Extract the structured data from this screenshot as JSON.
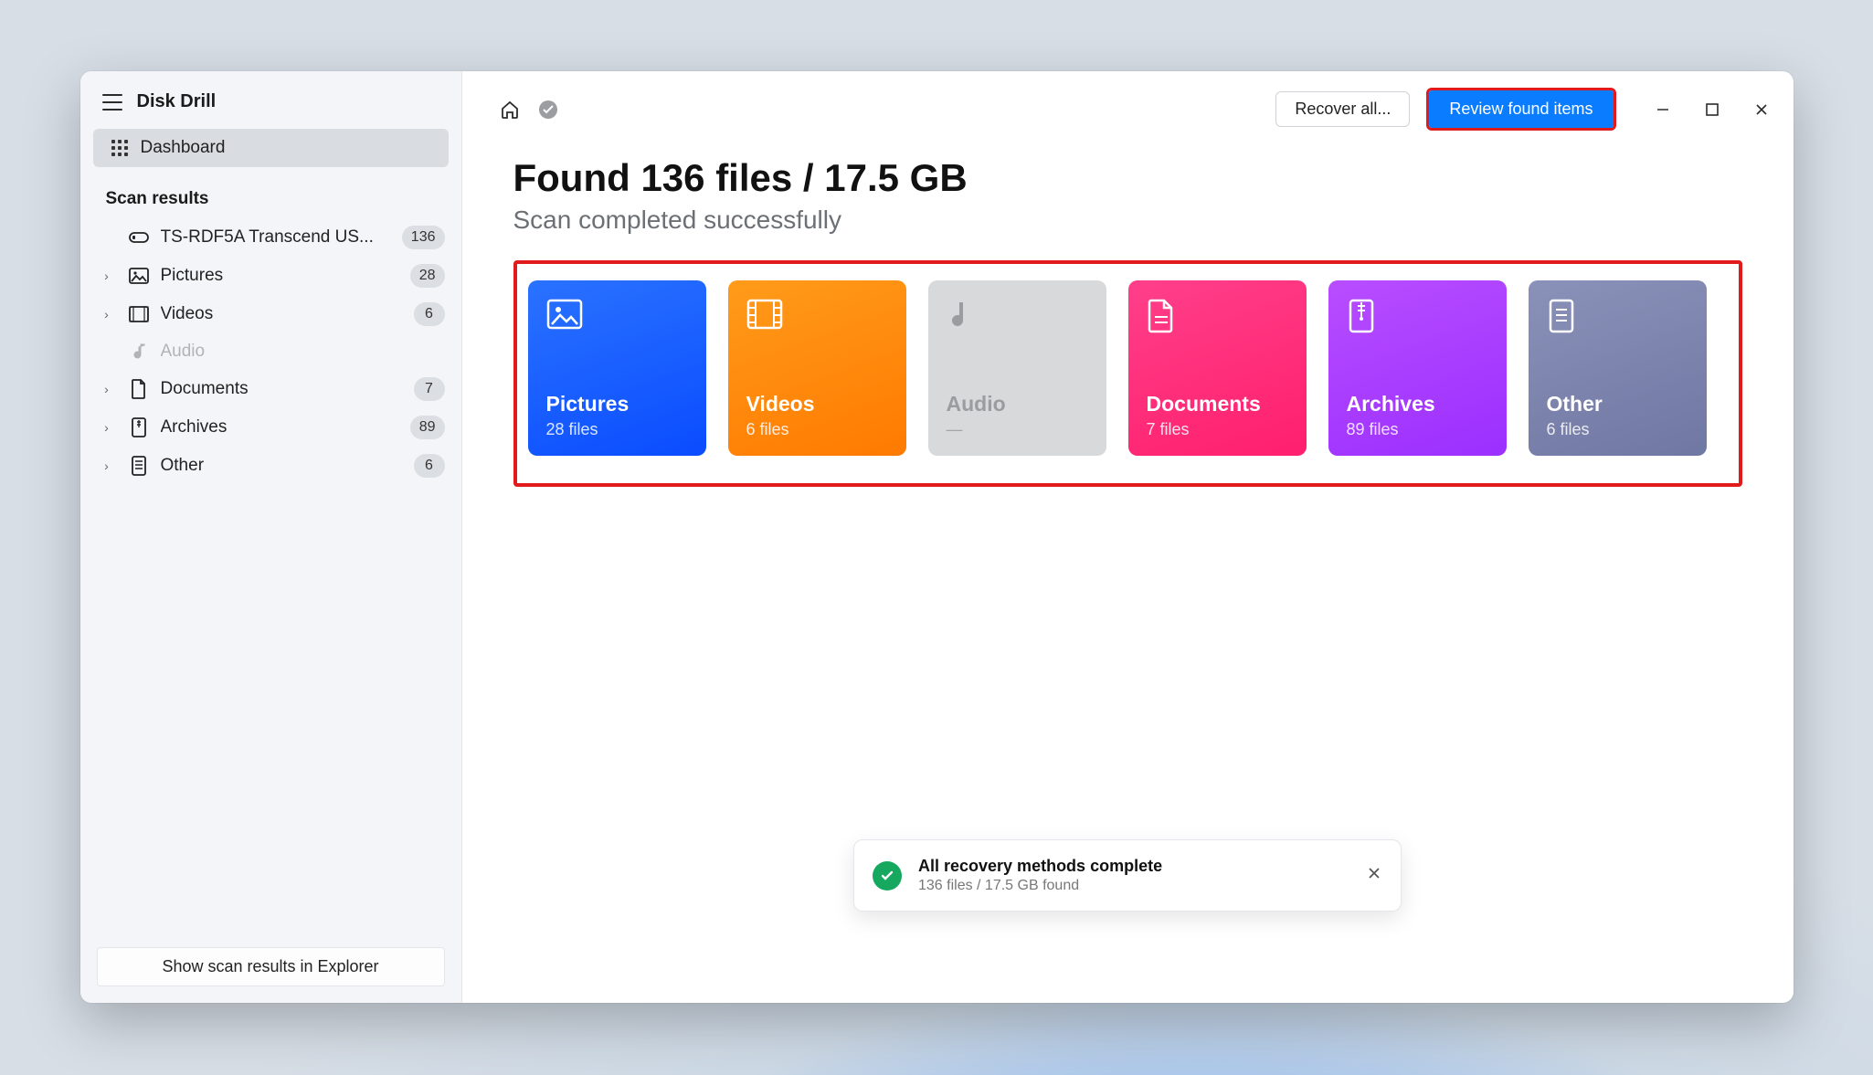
{
  "app": {
    "title": "Disk Drill"
  },
  "sidebar": {
    "dashboard_label": "Dashboard",
    "scan_heading": "Scan results",
    "device": {
      "label": "TS-RDF5A Transcend US...",
      "badge": "136"
    },
    "items": [
      {
        "label": "Pictures",
        "badge": "28"
      },
      {
        "label": "Videos",
        "badge": "6"
      },
      {
        "label": "Audio",
        "badge": ""
      },
      {
        "label": "Documents",
        "badge": "7"
      },
      {
        "label": "Archives",
        "badge": "89"
      },
      {
        "label": "Other",
        "badge": "6"
      }
    ],
    "explorer_button": "Show scan results in Explorer"
  },
  "toolbar": {
    "recover_all": "Recover all...",
    "review": "Review found items"
  },
  "main": {
    "heading": "Found 136 files / 17.5 GB",
    "subheading": "Scan completed successfully",
    "cards": [
      {
        "name": "Pictures",
        "count": "28 files"
      },
      {
        "name": "Videos",
        "count": "6 files"
      },
      {
        "name": "Audio",
        "count": "—"
      },
      {
        "name": "Documents",
        "count": "7 files"
      },
      {
        "name": "Archives",
        "count": "89 files"
      },
      {
        "name": "Other",
        "count": "6 files"
      }
    ]
  },
  "toast": {
    "title": "All recovery methods complete",
    "sub": "136 files / 17.5 GB found"
  }
}
